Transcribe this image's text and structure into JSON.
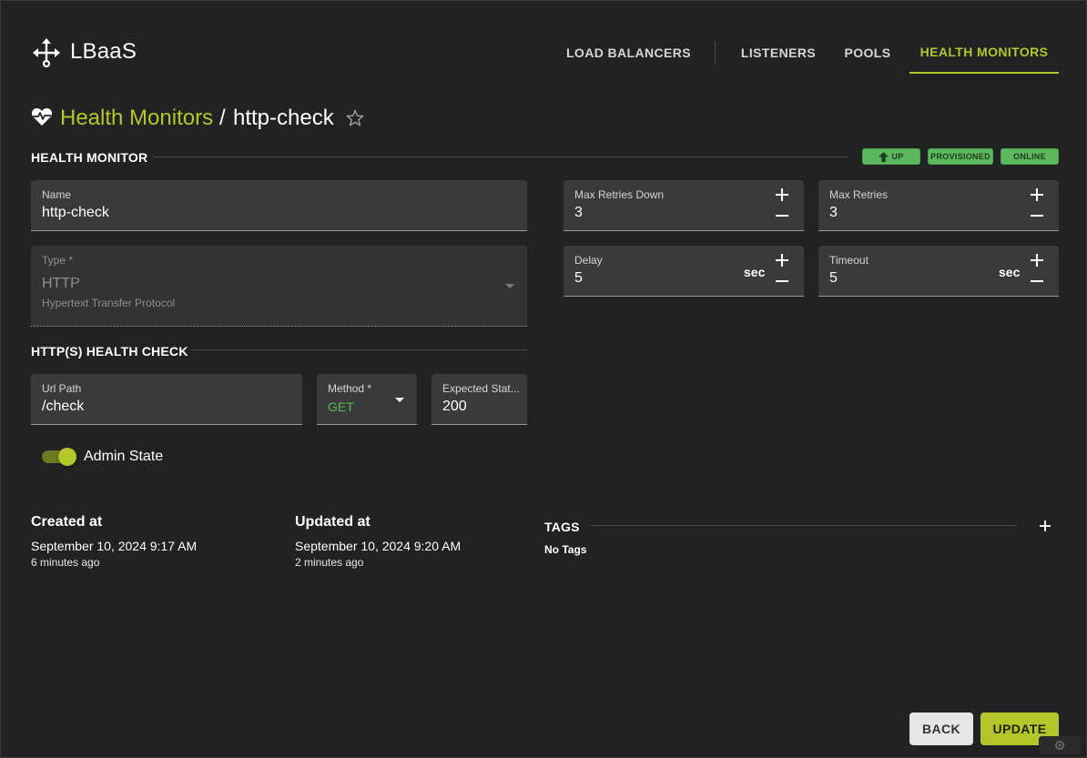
{
  "app": {
    "title": "LBaaS",
    "logo_icon": "network-hub-icon"
  },
  "nav": {
    "items": [
      {
        "label": "LOAD BALANCERS",
        "active": false
      },
      {
        "label": "LISTENERS",
        "active": false
      },
      {
        "label": "POOLS",
        "active": false
      },
      {
        "label": "HEALTH MONITORS",
        "active": true
      }
    ]
  },
  "breadcrumb": {
    "parent": "Health Monitors",
    "separator": "/",
    "current": "http-check"
  },
  "health_monitor": {
    "section_title": "HEALTH MONITOR",
    "badges": {
      "up": "UP",
      "provisioned": "PROVISIONED",
      "online": "ONLINE"
    },
    "name": {
      "label": "Name",
      "value": "http-check"
    },
    "type": {
      "label": "Type *",
      "value": "HTTP",
      "description": "Hypertext Transfer Protocol"
    },
    "max_retries_down": {
      "label": "Max Retries Down",
      "value": "3"
    },
    "max_retries": {
      "label": "Max Retries",
      "value": "3"
    },
    "delay": {
      "label": "Delay",
      "value": "5",
      "suffix": "sec"
    },
    "timeout": {
      "label": "Timeout",
      "value": "5",
      "suffix": "sec"
    }
  },
  "http_check": {
    "section_title": "HTTP(S) HEALTH CHECK",
    "url_path": {
      "label": "Url Path",
      "value": "/check"
    },
    "method": {
      "label": "Method *",
      "value": "GET"
    },
    "expected_status": {
      "label": "Expected Stat...",
      "value": "200"
    }
  },
  "admin_state": {
    "label": "Admin State",
    "enabled": true
  },
  "meta": {
    "created": {
      "label": "Created at",
      "date": "September 10, 2024 9:17 AM",
      "relative": "6 minutes ago"
    },
    "updated": {
      "label": "Updated at",
      "date": "September 10, 2024 9:20 AM",
      "relative": "2 minutes ago"
    }
  },
  "tags": {
    "title": "TAGS",
    "empty_text": "No Tags"
  },
  "actions": {
    "back": "BACK",
    "update": "UPDATE"
  },
  "colors": {
    "accent": "#b3c72a",
    "status_green": "#5cb85c",
    "background": "#222222",
    "field": "#3a3a3a"
  }
}
